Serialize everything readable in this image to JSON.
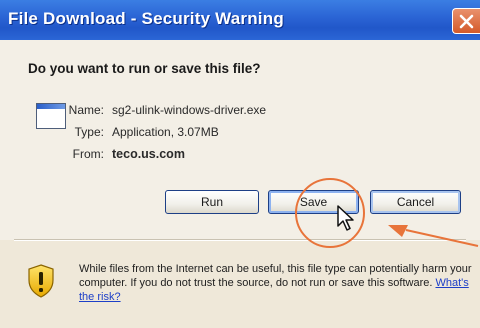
{
  "window": {
    "title": "File Download - Security Warning"
  },
  "prompt": {
    "question": "Do you want to run or save this file?"
  },
  "file": {
    "name_label": "Name:",
    "name_value": "sg2-ulink-windows-driver.exe",
    "type_label": "Type:",
    "type_value": "Application, 3.07MB",
    "from_label": "From:",
    "from_value": "teco.us.com"
  },
  "buttons": {
    "run": "Run",
    "save": "Save",
    "cancel": "Cancel"
  },
  "warning": {
    "text": "While files from the Internet can be useful, this file type can potentially harm your computer. If you do not trust the source, do not run or save this software.",
    "link": "What's the risk?"
  },
  "icons": {
    "close": "close-icon",
    "file": "application-file-icon",
    "shield": "security-shield-icon",
    "cursor": "mouse-cursor-icon"
  },
  "colors": {
    "titlebar": "#2a63d4",
    "close_button": "#d45a2a",
    "annotation": "#e8743a",
    "link": "#1d3fc8"
  }
}
